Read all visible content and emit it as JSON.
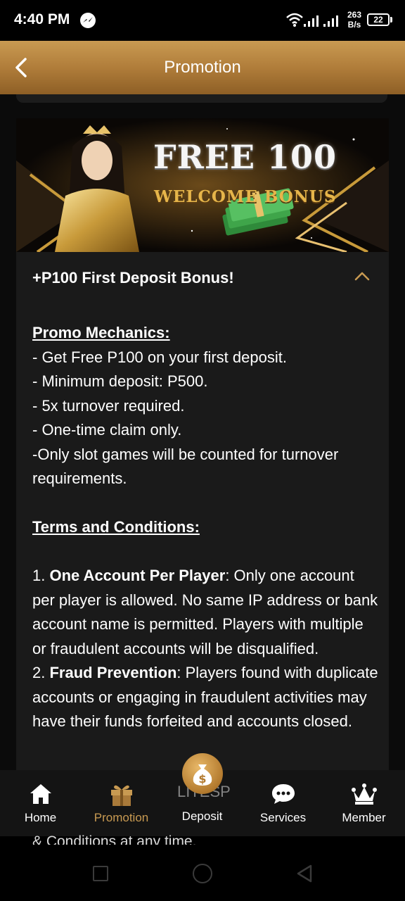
{
  "status_bar": {
    "time": "4:40 PM",
    "net_speed_value": "263",
    "net_speed_unit": "B/s",
    "battery": "22"
  },
  "header": {
    "title": "Promotion"
  },
  "banner": {
    "line1": "FREE 100",
    "line2": "WELCOME BONUS"
  },
  "promo": {
    "title": "+P100 First Deposit Bonus!",
    "mechanics_heading": "Promo Mechanics:",
    "mechanics": [
      "- Get Free P100 on your first deposit.",
      "- Minimum deposit: P500.",
      "- 5x turnover required.",
      "- One-time claim only.",
      "-Only slot games will be counted for turnover requirements."
    ],
    "terms_heading": "Terms and Conditions:",
    "terms": [
      {
        "num": "1. ",
        "title": "One Account Per Player",
        "text": ": Only one account per player is allowed. No same IP address or bank account name is permitted. Players with multiple or fraudulent accounts will be disqualified."
      },
      {
        "num": "2. ",
        "title": "Fraud Prevention",
        "text": ": Players found with duplicate accounts or engaging in fraudulent activities may have their funds forfeited and accounts closed."
      }
    ]
  },
  "overlay": {
    "ghost_text": "LITESP",
    "bleed_text": "& Conditions at any time."
  },
  "nav": {
    "items": [
      {
        "label": "Home"
      },
      {
        "label": "Promotion"
      },
      {
        "label": "Deposit"
      },
      {
        "label": "Services"
      },
      {
        "label": "Member"
      }
    ]
  },
  "colors": {
    "accent": "#c89a52",
    "header_top": "#c99a52",
    "header_bottom": "#8e5f26",
    "background": "#0b0b0b",
    "card": "#1a1a1a"
  }
}
